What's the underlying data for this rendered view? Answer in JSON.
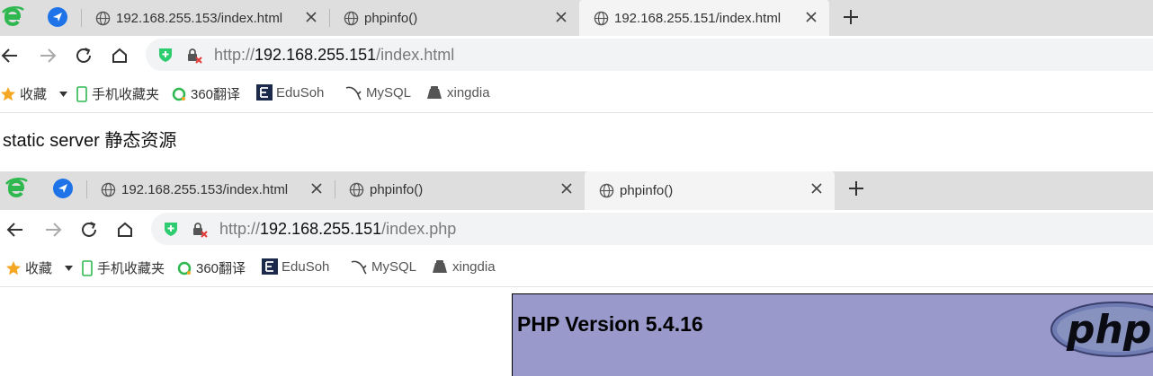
{
  "windows": [
    {
      "tabs": [
        {
          "title": "192.168.255.153/index.html",
          "active": false
        },
        {
          "title": "phpinfo()",
          "active": false
        },
        {
          "title": "192.168.255.151/index.html",
          "active": true
        }
      ],
      "address": {
        "scheme": "http://",
        "host": "192.168.255.151",
        "path": "/index.html"
      },
      "content_text": "static server 静态资源"
    },
    {
      "tabs": [
        {
          "title": "192.168.255.153/index.html",
          "active": false
        },
        {
          "title": "phpinfo()",
          "active": false
        },
        {
          "title": "phpinfo()",
          "active": true
        }
      ],
      "address": {
        "scheme": "http://",
        "host": "192.168.255.151",
        "path": "/index.php"
      },
      "php_version_title": "PHP Version 5.4.16",
      "php_logo_text": "php"
    }
  ],
  "bookmarks": {
    "favorites": "收藏",
    "mobile": "手机收藏夹",
    "translate": "360翻译",
    "edusoho": "EduSoh",
    "mysql": "MySQL",
    "xingdian": "xingdia"
  },
  "colors": {
    "tabstrip": "#dedede",
    "active_tab": "#f4f4f4",
    "php_panel": "#9999cc",
    "ie_logo": "#2fb84f",
    "nav_blue": "#1e73e8"
  }
}
